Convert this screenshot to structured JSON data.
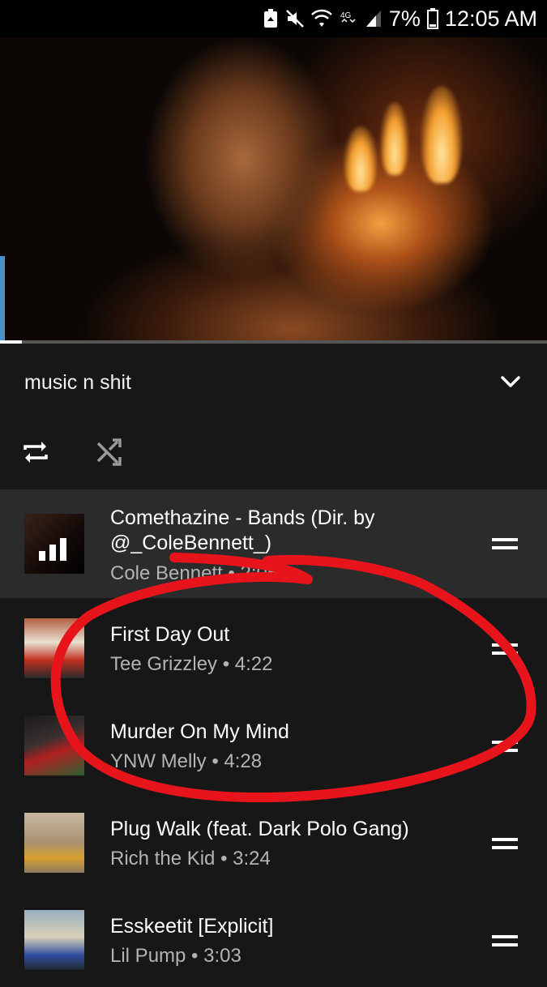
{
  "status_bar": {
    "battery_percent": "7%",
    "time": "12:05 AM",
    "network": "4G",
    "icons": [
      "recycle-icon",
      "mute-icon",
      "wifi-icon",
      "lte-icon",
      "signal-icon",
      "battery-icon"
    ]
  },
  "player": {
    "progress_fraction": 0.04
  },
  "playlist": {
    "title": "music n shit",
    "icons": {
      "collapse": "chevron-down-icon",
      "repeat": "repeat-icon",
      "shuffle": "shuffle-icon"
    }
  },
  "tracks": [
    {
      "title": "Comethazine - Bands (Dir. by @_ColeBennett_)",
      "artist": "Cole Bennett",
      "duration": "2:05",
      "subtitle": "Cole Bennett • 2:05",
      "now_playing": true
    },
    {
      "title": "First Day Out",
      "artist": "Tee Grizzley",
      "duration": "4:22",
      "subtitle": "Tee Grizzley • 4:22",
      "now_playing": false
    },
    {
      "title": "Murder On My Mind",
      "artist": "YNW Melly",
      "duration": "4:28",
      "subtitle": "YNW Melly • 4:28",
      "now_playing": false
    },
    {
      "title": "Plug Walk (feat. Dark Polo Gang)",
      "artist": "Rich the Kid",
      "duration": "3:24",
      "subtitle": "Rich the Kid • 3:24",
      "now_playing": false
    },
    {
      "title": "Esskeetit [Explicit]",
      "artist": "Lil Pump",
      "duration": "3:03",
      "subtitle": "Lil Pump • 3:03",
      "now_playing": false
    }
  ],
  "colors": {
    "background": "#171717",
    "active_row": "#2b2b2b",
    "annotation_red": "#e8141c",
    "secondary_text": "#b3b3b3"
  }
}
